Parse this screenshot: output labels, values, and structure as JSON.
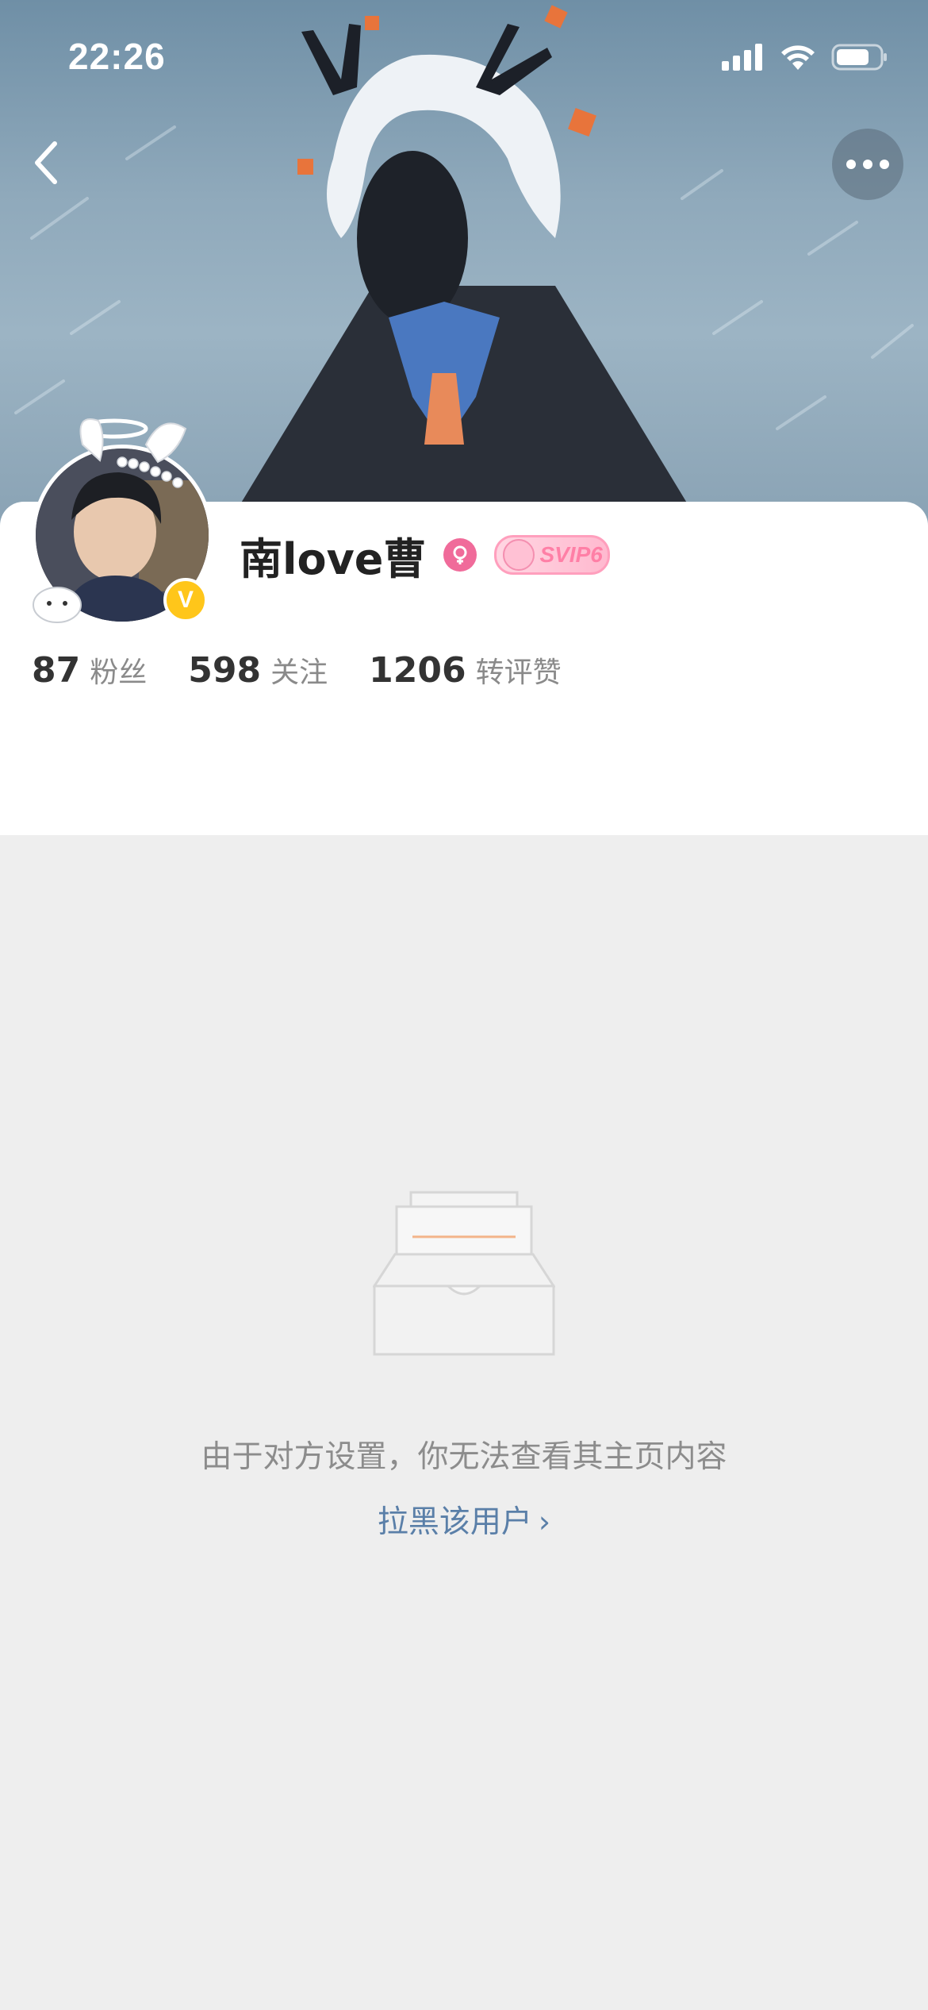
{
  "status_bar": {
    "time": "22:26",
    "icons": [
      "signal-icon",
      "wifi-icon",
      "battery-icon"
    ]
  },
  "header": {
    "back_icon": "chevron-left-icon",
    "more_icon": "more-dots-icon"
  },
  "profile": {
    "username": "南love曹",
    "gender_icon": "female-icon",
    "verified_badge": "V",
    "svip_badge": "SVIP6",
    "stats": [
      {
        "value": "87",
        "label": "粉丝"
      },
      {
        "value": "598",
        "label": "关注"
      },
      {
        "value": "1206",
        "label": "转评赞"
      }
    ]
  },
  "empty_state": {
    "icon": "empty-inbox-icon",
    "message": "由于对方设置，你无法查看其主页内容",
    "block_link": "拉黑该用户",
    "link_chevron": "›"
  },
  "colors": {
    "background": "#eeeeee",
    "card": "#ffffff",
    "link": "#5a7fa8",
    "verified": "#ffc61a",
    "gender": "#f06b9a",
    "svip": "#ff7fa6"
  }
}
